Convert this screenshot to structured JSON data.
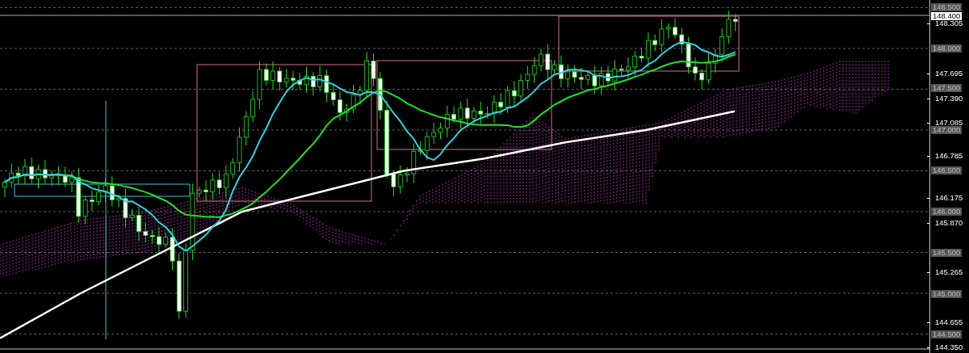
{
  "price_axis": {
    "labels": [
      {
        "text": "148.500",
        "kind": "level"
      },
      {
        "text": "148.400",
        "kind": "current"
      },
      {
        "text": "148.305",
        "kind": "tick"
      },
      {
        "text": "148.000",
        "kind": "level"
      },
      {
        "text": "147.695",
        "kind": "tick"
      },
      {
        "text": "147.500",
        "kind": "level"
      },
      {
        "text": "147.390",
        "kind": "tick"
      },
      {
        "text": "147.085",
        "kind": "tick"
      },
      {
        "text": "147.000",
        "kind": "level"
      },
      {
        "text": "146.785",
        "kind": "tick"
      },
      {
        "text": "146.500",
        "kind": "level"
      },
      {
        "text": "146.175",
        "kind": "tick"
      },
      {
        "text": "146.000",
        "kind": "level"
      },
      {
        "text": "145.870",
        "kind": "tick"
      },
      {
        "text": "145.500",
        "kind": "level"
      },
      {
        "text": "145.265",
        "kind": "tick"
      },
      {
        "text": "145.000",
        "kind": "level"
      },
      {
        "text": "144.655",
        "kind": "tick"
      },
      {
        "text": "144.500",
        "kind": "level"
      },
      {
        "text": "144.350",
        "kind": "tick"
      }
    ]
  }
}
